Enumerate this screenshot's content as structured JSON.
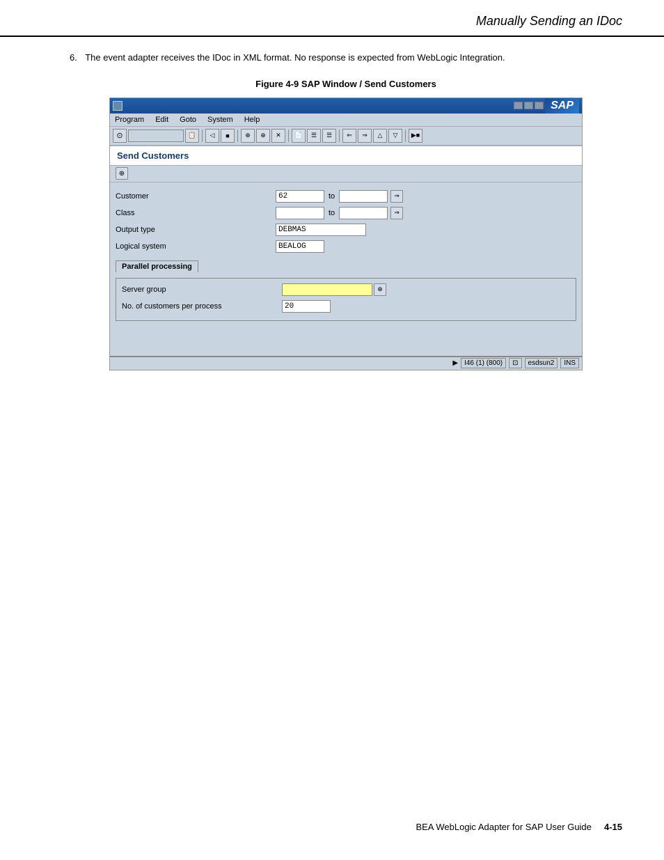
{
  "page": {
    "title": "Manually Sending an IDoc",
    "footer_text": "BEA WebLogic Adapter for SAP User Guide",
    "footer_page": "4-15"
  },
  "step": {
    "number": "6.",
    "text": "The event adapter receives the IDoc in XML format. No response is expected from WebLogic Integration."
  },
  "figure": {
    "caption": "Figure 4-9   SAP Window / Send Customers"
  },
  "sap": {
    "titlebar": {
      "icon_char": "⊡",
      "title": "",
      "logo": "SAP"
    },
    "menubar": {
      "items": [
        "Program",
        "Edit",
        "Goto",
        "System",
        "Help"
      ]
    },
    "window_title": "Send Customers",
    "action_icon": "⊕",
    "form": {
      "fields": [
        {
          "label": "Customer",
          "value": "62",
          "has_to": true,
          "to_value": "",
          "has_arrow": true
        },
        {
          "label": "Class",
          "value": "",
          "has_to": true,
          "to_value": "",
          "has_arrow": true
        },
        {
          "label": "Output type",
          "value": "DEBMAS",
          "has_to": false,
          "to_value": "",
          "has_arrow": false
        },
        {
          "label": "Logical system",
          "value": "BEALOG",
          "has_to": false,
          "to_value": "",
          "has_arrow": false
        }
      ]
    },
    "parallel_section": {
      "header": "Parallel processing",
      "server_group_label": "Server group",
      "server_group_value": "",
      "customers_label": "No. of customers per process",
      "customers_value": "20"
    },
    "statusbar": {
      "arrow": "▶",
      "item1": "I46 (1) (800)",
      "item2": "⊡",
      "item3": "esdsun2",
      "item4": "INS"
    }
  }
}
